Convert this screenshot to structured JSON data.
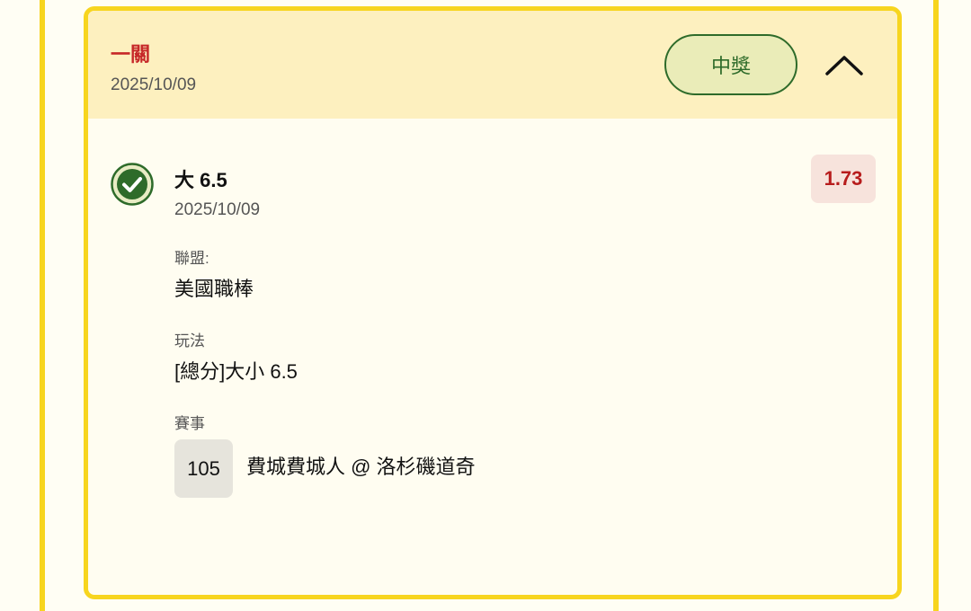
{
  "header": {
    "bet_type": "一關",
    "date": "2025/10/09",
    "status": "中獎"
  },
  "selection": {
    "name": "大 6.5",
    "date": "2025/10/09",
    "odds": "1.73",
    "league_label": "聯盟:",
    "league_value": "美國職棒",
    "market_label": "玩法",
    "market_value": "[總分]大小 6.5",
    "event_label": "賽事",
    "event_number": "105",
    "event_matchup": "費城費城人 @ 洛杉磯道奇"
  },
  "icons": {
    "collapse": "chevron-up-icon",
    "result": "check-circle-icon"
  },
  "colors": {
    "accent_border": "#f7d51f",
    "win_green": "#2e6b2a",
    "odds_red": "#b71c1c",
    "bet_type_red": "#c62828"
  }
}
